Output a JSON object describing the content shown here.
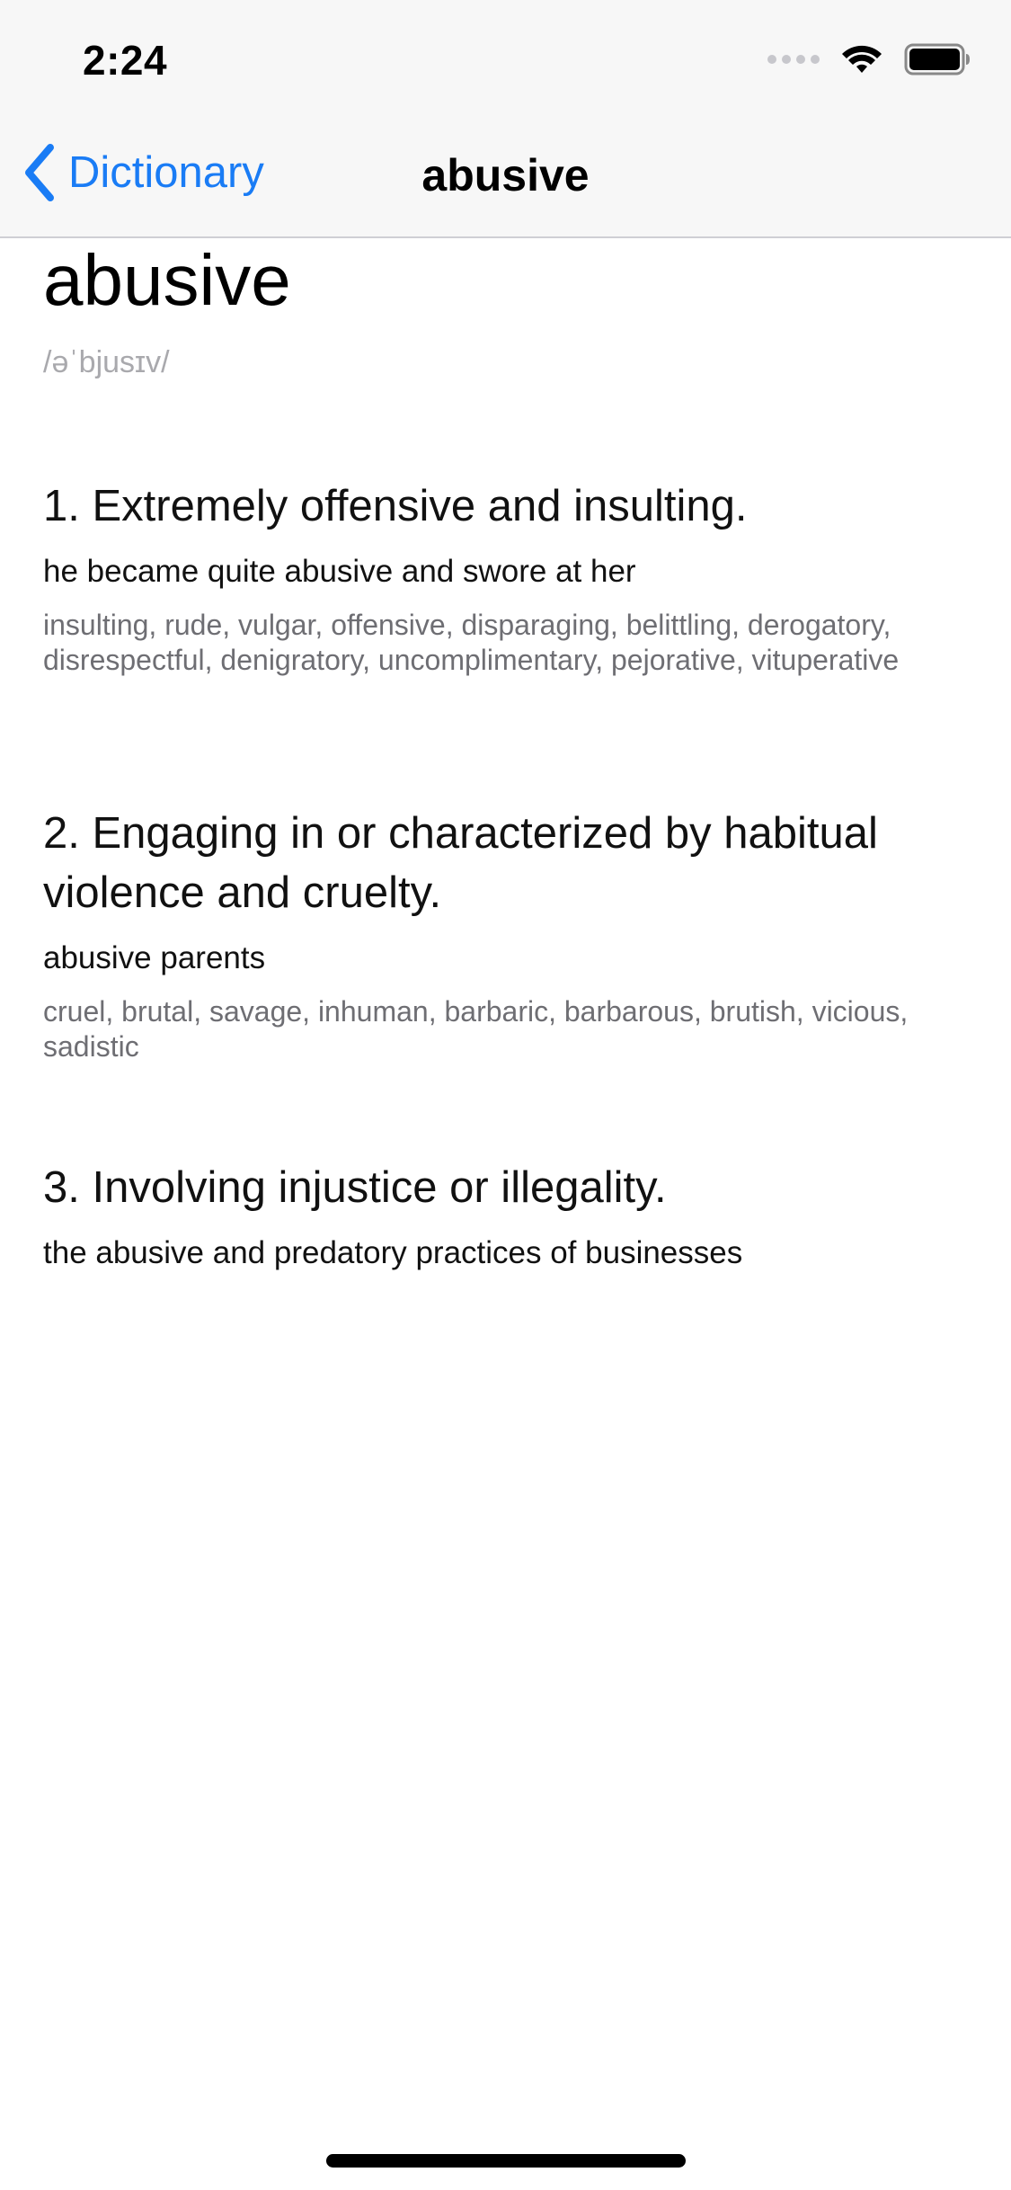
{
  "status_bar": {
    "time": "2:24"
  },
  "nav": {
    "back_label": "Dictionary",
    "title": "abusive"
  },
  "entry": {
    "headword": "abusive",
    "pronunciation": "/əˈbjusɪv/",
    "senses": [
      {
        "definition": "1. Extremely offensive and insulting.",
        "example": "he became quite abusive and swore at her",
        "synonyms": "insulting, rude, vulgar, offensive, disparaging, belittling, derogatory, disrespectful, denigratory, uncomplimentary, pejorative, vituperative"
      },
      {
        "definition": "2. Engaging in or characterized by habitual violence and cruelty.",
        "example": "abusive parents",
        "synonyms": "cruel, brutal, savage, inhuman, barbaric, barbarous, brutish, vicious, sadistic"
      },
      {
        "definition": "3. Involving injustice or illegality.",
        "example": "the abusive and predatory practices of businesses"
      }
    ]
  },
  "colors": {
    "accent": "#1a7cf5",
    "nav_background": "#f7f7f7",
    "secondary_text": "#6e6e73",
    "pronunciation_text": "#a9a9ad"
  },
  "icons": {
    "back": "chevron-left-icon",
    "wifi": "wifi-icon",
    "battery": "battery-icon",
    "signal": "cellular-signal-icon"
  }
}
